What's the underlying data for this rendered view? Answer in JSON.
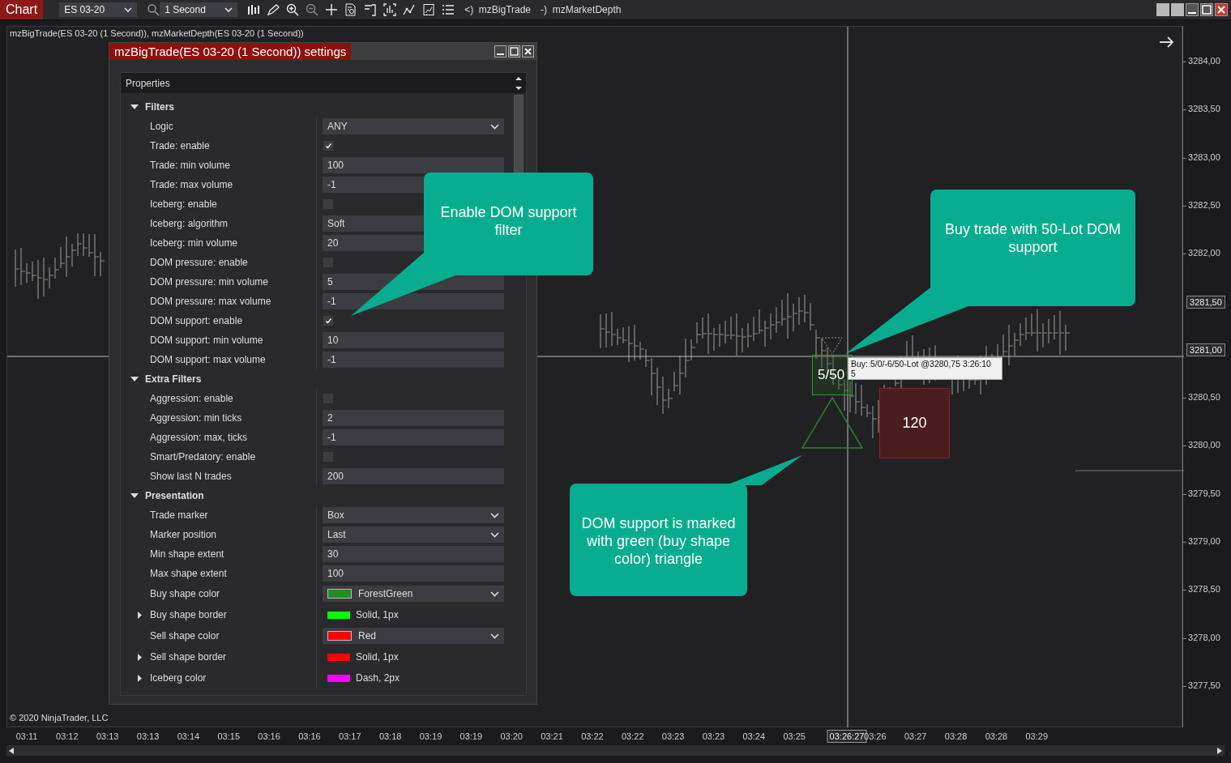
{
  "toolbar": {
    "tab": "Chart",
    "instrument": "ES 03-20",
    "interval": "1 Second",
    "indicators": [
      "<)  mzBigTrade",
      "-)  mzMarketDepth"
    ]
  },
  "chart": {
    "label": "mzBigTrade(ES 03-20 (1 Second)), mzMarketDepth(ES 03-20 (1 Second))",
    "copyright": "© 2020 NinjaTrader, LLC",
    "price_labels": [
      {
        "text": "3284,00",
        "kind": "tick"
      },
      {
        "text": "3283,50",
        "kind": "tick"
      },
      {
        "text": "3283,00",
        "kind": "tick"
      },
      {
        "text": "3282,50",
        "kind": "tick"
      },
      {
        "text": "3282,00",
        "kind": "tick"
      },
      {
        "text": "3281,50",
        "kind": "badge"
      },
      {
        "text": "3281,00",
        "kind": "badge"
      },
      {
        "text": "3280,50",
        "kind": "tick"
      },
      {
        "text": "3280,00",
        "kind": "tick"
      },
      {
        "text": "3279,50",
        "kind": "tick"
      },
      {
        "text": "3279,00",
        "kind": "tick"
      },
      {
        "text": "3278,50",
        "kind": "tick"
      },
      {
        "text": "3278,00",
        "kind": "tick"
      },
      {
        "text": "3277,50",
        "kind": "tick"
      }
    ],
    "time_labels": [
      {
        "text": "03:11",
        "kind": "tick"
      },
      {
        "text": "03:12",
        "kind": "tick"
      },
      {
        "text": "03:13",
        "kind": "tick"
      },
      {
        "text": "03:13",
        "kind": "tick"
      },
      {
        "text": "03:14",
        "kind": "tick"
      },
      {
        "text": "03:15",
        "kind": "tick"
      },
      {
        "text": "03:16",
        "kind": "tick"
      },
      {
        "text": "03:16",
        "kind": "tick"
      },
      {
        "text": "03:17",
        "kind": "tick"
      },
      {
        "text": "03:18",
        "kind": "tick"
      },
      {
        "text": "03:19",
        "kind": "tick"
      },
      {
        "text": "03:19",
        "kind": "tick"
      },
      {
        "text": "03:20",
        "kind": "tick"
      },
      {
        "text": "03:21",
        "kind": "tick"
      },
      {
        "text": "03:22",
        "kind": "tick"
      },
      {
        "text": "03:22",
        "kind": "tick"
      },
      {
        "text": "03:23",
        "kind": "tick"
      },
      {
        "text": "03:23",
        "kind": "tick"
      },
      {
        "text": "03:24",
        "kind": "tick"
      },
      {
        "text": "03:25",
        "kind": "tick"
      },
      {
        "text": "03:26:27",
        "kind": "cursor"
      },
      {
        "text": "03:26",
        "kind": "tick"
      },
      {
        "text": "03:27",
        "kind": "tick"
      },
      {
        "text": "03:28",
        "kind": "tick"
      },
      {
        "text": "03:28",
        "kind": "tick"
      },
      {
        "text": "03:29",
        "kind": "tick"
      }
    ],
    "markers": [
      {
        "kind": "buy",
        "text": "5/50"
      },
      {
        "kind": "sell",
        "text": "120"
      }
    ],
    "tooltip": [
      "Buy:  5/0/-6/50-Lot  @3280,75  3:26:10",
      "5"
    ]
  },
  "dialog": {
    "title": "mzBigTrade(ES 03-20 (1 Second)) settings",
    "header": "Properties",
    "sections": [
      {
        "title": "Filters",
        "expanded": true,
        "rows": [
          {
            "label": "Logic",
            "kind": "dropdown",
            "value": "ANY"
          },
          {
            "label": "Trade: enable",
            "kind": "check",
            "checked": true
          },
          {
            "label": "Trade: min volume",
            "kind": "text",
            "value": "100"
          },
          {
            "label": "Trade: max volume",
            "kind": "text",
            "value": "-1"
          },
          {
            "label": "Iceberg: enable",
            "kind": "check",
            "checked": false
          },
          {
            "label": "Iceberg: algorithm",
            "kind": "text",
            "value": "Soft"
          },
          {
            "label": "Iceberg: min volume",
            "kind": "text",
            "value": "20"
          },
          {
            "label": "DOM pressure: enable",
            "kind": "check",
            "checked": false
          },
          {
            "label": "DOM pressure: min volume",
            "kind": "text",
            "value": "5"
          },
          {
            "label": "DOM pressure: max volume",
            "kind": "text",
            "value": "-1"
          },
          {
            "label": "DOM support: enable",
            "kind": "check",
            "checked": true
          },
          {
            "label": "DOM support: min volume",
            "kind": "text",
            "value": "10"
          },
          {
            "label": "DOM support: max volume",
            "kind": "text",
            "value": "-1"
          }
        ]
      },
      {
        "title": "Extra Filters",
        "expanded": true,
        "rows": [
          {
            "label": "Aggression: enable",
            "kind": "check",
            "checked": false
          },
          {
            "label": "Aggression: min ticks",
            "kind": "text",
            "value": "2"
          },
          {
            "label": "Aggression: max, ticks",
            "kind": "text",
            "value": "-1"
          },
          {
            "label": "Smart/Predatory: enable",
            "kind": "check",
            "checked": false
          },
          {
            "label": "Show last N trades",
            "kind": "text",
            "value": "200"
          }
        ]
      },
      {
        "title": "Presentation",
        "expanded": true,
        "rows": [
          {
            "label": "Trade marker",
            "kind": "dropdown",
            "value": "Box"
          },
          {
            "label": "Marker position",
            "kind": "dropdown",
            "value": "Last"
          },
          {
            "label": "Min shape extent",
            "kind": "text",
            "value": "30"
          },
          {
            "label": "Max shape extent",
            "kind": "text",
            "value": "100"
          },
          {
            "label": "Buy shape color",
            "kind": "color",
            "value": "ForestGreen",
            "color": "#228b22"
          },
          {
            "label": "Buy shape border",
            "kind": "stroke",
            "value": "Solid, 1px",
            "color": "#00ff00",
            "expanded": false
          },
          {
            "label": "Sell shape color",
            "kind": "color",
            "value": "Red",
            "color": "#ff0000"
          },
          {
            "label": "Sell shape border",
            "kind": "stroke",
            "value": "Solid, 1px",
            "color": "#ff0000",
            "expanded": false
          },
          {
            "label": "Iceberg color",
            "kind": "stroke",
            "value": "Dash, 2px",
            "color": "#ff00ff",
            "expanded": false
          }
        ]
      }
    ]
  },
  "callouts": [
    {
      "text": "Enable DOM support filter"
    },
    {
      "text": "Buy trade with 50-Lot DOM support"
    },
    {
      "text": "DOM support is marked with green (buy shape color) triangle"
    }
  ]
}
